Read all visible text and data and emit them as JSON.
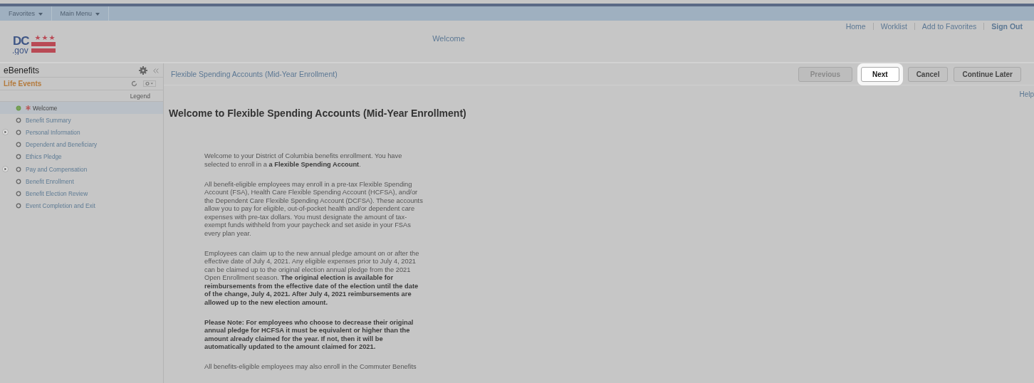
{
  "menu_bar": {
    "items": [
      {
        "label": "Favorites"
      },
      {
        "label": "Main Menu"
      }
    ]
  },
  "header": {
    "logo": {
      "text": "DC",
      "subtext": ".gov"
    },
    "title": "Welcome",
    "links": [
      {
        "label": "Home",
        "bold": false
      },
      {
        "label": "Worklist",
        "bold": false
      },
      {
        "label": "Add to Favorites",
        "bold": false
      },
      {
        "label": "Sign Out",
        "bold": true
      }
    ]
  },
  "sidebar": {
    "title": "eBenefits",
    "section": "Life Events",
    "legend": "Legend",
    "items": [
      {
        "label": "Welcome",
        "selected": true,
        "required": true,
        "expandable": false
      },
      {
        "label": "Benefit Summary",
        "selected": false,
        "required": false,
        "expandable": false
      },
      {
        "label": "Personal Information",
        "selected": false,
        "required": false,
        "expandable": true
      },
      {
        "label": "Dependent and Beneficiary",
        "selected": false,
        "required": false,
        "expandable": false
      },
      {
        "label": "Ethics Pledge",
        "selected": false,
        "required": false,
        "expandable": false
      },
      {
        "label": "Pay and Compensation",
        "selected": false,
        "required": false,
        "expandable": true
      },
      {
        "label": "Benefit Enrollment",
        "selected": false,
        "required": false,
        "expandable": false
      },
      {
        "label": "Benefit Election Review",
        "selected": false,
        "required": false,
        "expandable": false
      },
      {
        "label": "Event Completion and Exit",
        "selected": false,
        "required": false,
        "expandable": false
      }
    ]
  },
  "content": {
    "breadcrumb": "Flexible Spending Accounts (Mid-Year Enrollment)",
    "buttons": [
      {
        "label": "Previous",
        "disabled": true,
        "highlighted": false
      },
      {
        "label": "Next",
        "disabled": false,
        "highlighted": true
      },
      {
        "label": "Cancel",
        "disabled": false,
        "highlighted": false
      },
      {
        "label": "Continue Later",
        "disabled": false,
        "highlighted": false
      }
    ],
    "help": "Help",
    "heading": "Welcome to Flexible Spending Accounts (Mid-Year Enrollment)",
    "paragraphs": [
      "Welcome to your District of Columbia benefits enrollment. You have selected to enroll in a **a Flexible Spending Account**.",
      "All benefit-eligible employees may enroll in a pre-tax Flexible Spending Account (FSA), Health Care Flexible Spending Account (HCFSA), and/or the Dependent Care Flexible Spending Account (DCFSA). These accounts allow you to pay for eligible, out-of-pocket health and/or dependent care expenses with pre-tax dollars. You must designate the amount of tax-exempt funds withheld from your paycheck and set aside in your FSAs every plan year.",
      "Employees can claim up to the new annual pledge amount on or after the effective date of July 4, 2021. Any eligible expenses prior to July 4, 2021 can be claimed up to the original election annual pledge from the 2021 Open Enrollment season. **The original election is available for reimbursements from the effective date of the election until the date of the change, July 4, 2021. After July 4, 2021 reimbursements are allowed up to the new election amount.**",
      "**Please Note: For employees who choose to decrease their original annual pledge for HCFSA it must be equivalent or higher than the amount already claimed for the year. If not, then it will be automatically updated to the amount claimed for 2021.**",
      "All benefits-eligible employees may also enroll in the Commuter Benefits"
    ]
  }
}
